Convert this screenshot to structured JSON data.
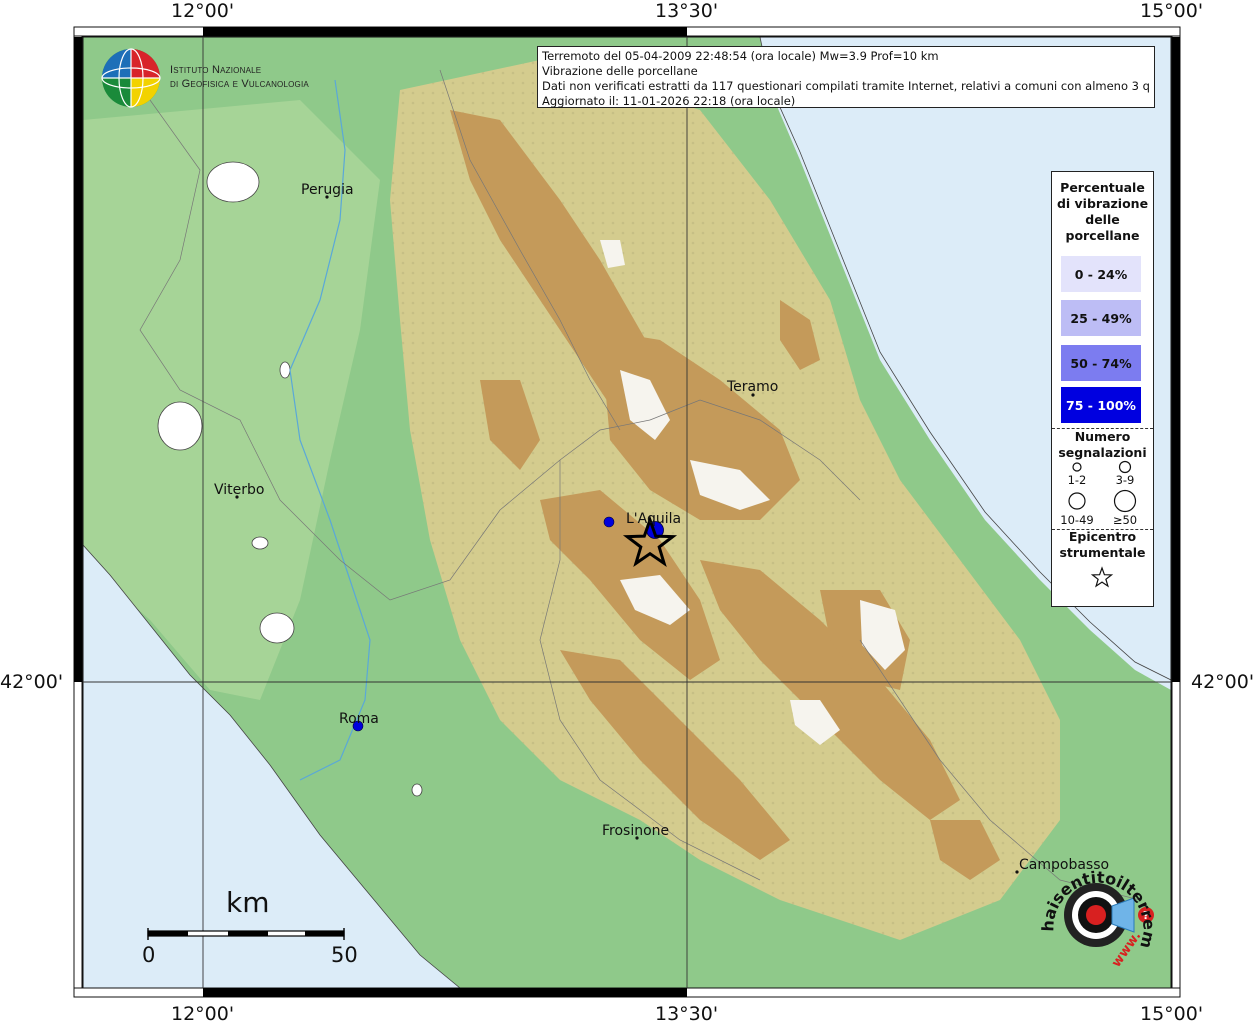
{
  "axes": {
    "top": [
      "12°00'",
      "13°30'",
      "15°00'"
    ],
    "bottom": [
      "12°00'",
      "13°30'",
      "15°00'"
    ],
    "left": [
      "42°00'"
    ],
    "right": [
      "42°00'"
    ]
  },
  "institute": {
    "line1": "Istituto Nazionale",
    "line2": "di Geofisica e Vulcanologia"
  },
  "info": {
    "line1": "Terremoto del 05-04-2009 22:48:54 (ora locale) Mw=3.9 Prof=10 km",
    "line2": "Vibrazione delle porcellane",
    "line3": "Dati non verificati estratti da 117 questionari compilati tramite Internet, relativi a comuni con almeno 3 questionari.",
    "line4": "Aggiornato il: 11-01-2026 22:18 (ora locale)"
  },
  "legend": {
    "title1": "Percentuale",
    "title2": "di vibrazione",
    "title3": "delle",
    "title4": "porcellane",
    "classes": [
      {
        "label": "0 - 24%",
        "color": "#e3e3fb",
        "text": "#111"
      },
      {
        "label": "25 - 49%",
        "color": "#bdbdf5",
        "text": "#111"
      },
      {
        "label": "50 - 74%",
        "color": "#7c7cf0",
        "text": "#111"
      },
      {
        "label": "75 - 100%",
        "color": "#0000e0",
        "text": "#ffffff"
      }
    ],
    "count_title1": "Numero",
    "count_title2": "segnalazioni",
    "count_labels": [
      "1-2",
      "3-9",
      "10-49",
      "≥50"
    ],
    "epi_title1": "Epicentro",
    "epi_title2": "strumentale"
  },
  "cities": [
    {
      "name": "Perugia"
    },
    {
      "name": "Teramo"
    },
    {
      "name": "Viterbo"
    },
    {
      "name": "L'Aquila"
    },
    {
      "name": "Roma"
    },
    {
      "name": "Frosinone"
    },
    {
      "name": "Campobasso"
    }
  ],
  "scalebar": {
    "unit": "km",
    "min": "0",
    "max": "50"
  },
  "badge": {
    "arc": "haisentitoilterremoto.it",
    "arc_www": "www."
  },
  "colors": {
    "sea": "#dcecf8",
    "lowland": "#8fc98a",
    "hills": "#d9cf90",
    "mountains": "#c49a5a",
    "peaks": "#ffffff",
    "point": "#0000dd"
  }
}
